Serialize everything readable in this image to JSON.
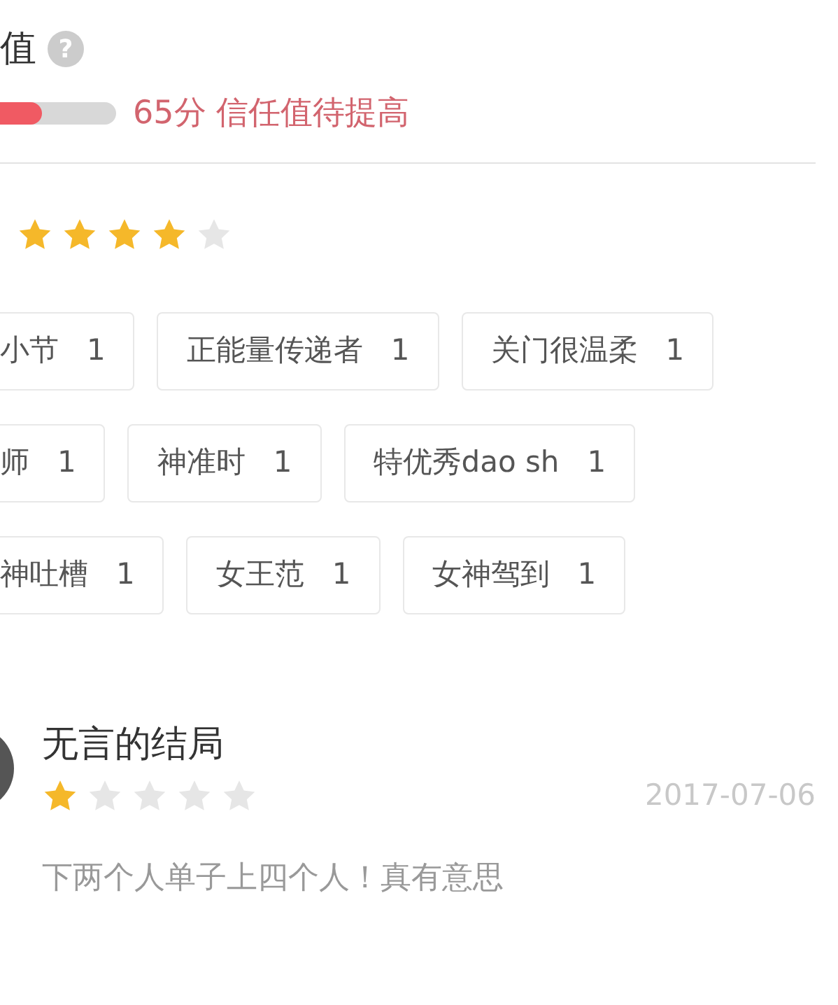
{
  "trust": {
    "title": "值",
    "help_icon": "?",
    "level": 0.65,
    "score": "65分",
    "verdict": "信任值待提高"
  },
  "rating": {
    "stars": 4
  },
  "tag_rows": [
    [
      {
        "label": "小节",
        "count": "1"
      },
      {
        "label": "正能量传递者",
        "count": "1"
      },
      {
        "label": "关门很温柔",
        "count": "1"
      }
    ],
    [
      {
        "label": "师",
        "count": "1"
      },
      {
        "label": "神准时",
        "count": "1"
      },
      {
        "label": "特优秀dao sh",
        "count": "1"
      }
    ],
    [
      {
        "label": "神吐槽",
        "count": "1"
      },
      {
        "label": "女王范",
        "count": "1"
      },
      {
        "label": "女神驾到",
        "count": "1"
      }
    ]
  ],
  "review": {
    "name": "无言的结局",
    "stars": 1,
    "date": "2017-07-06",
    "comment": "下两个人单子上四个人！真有意思"
  }
}
